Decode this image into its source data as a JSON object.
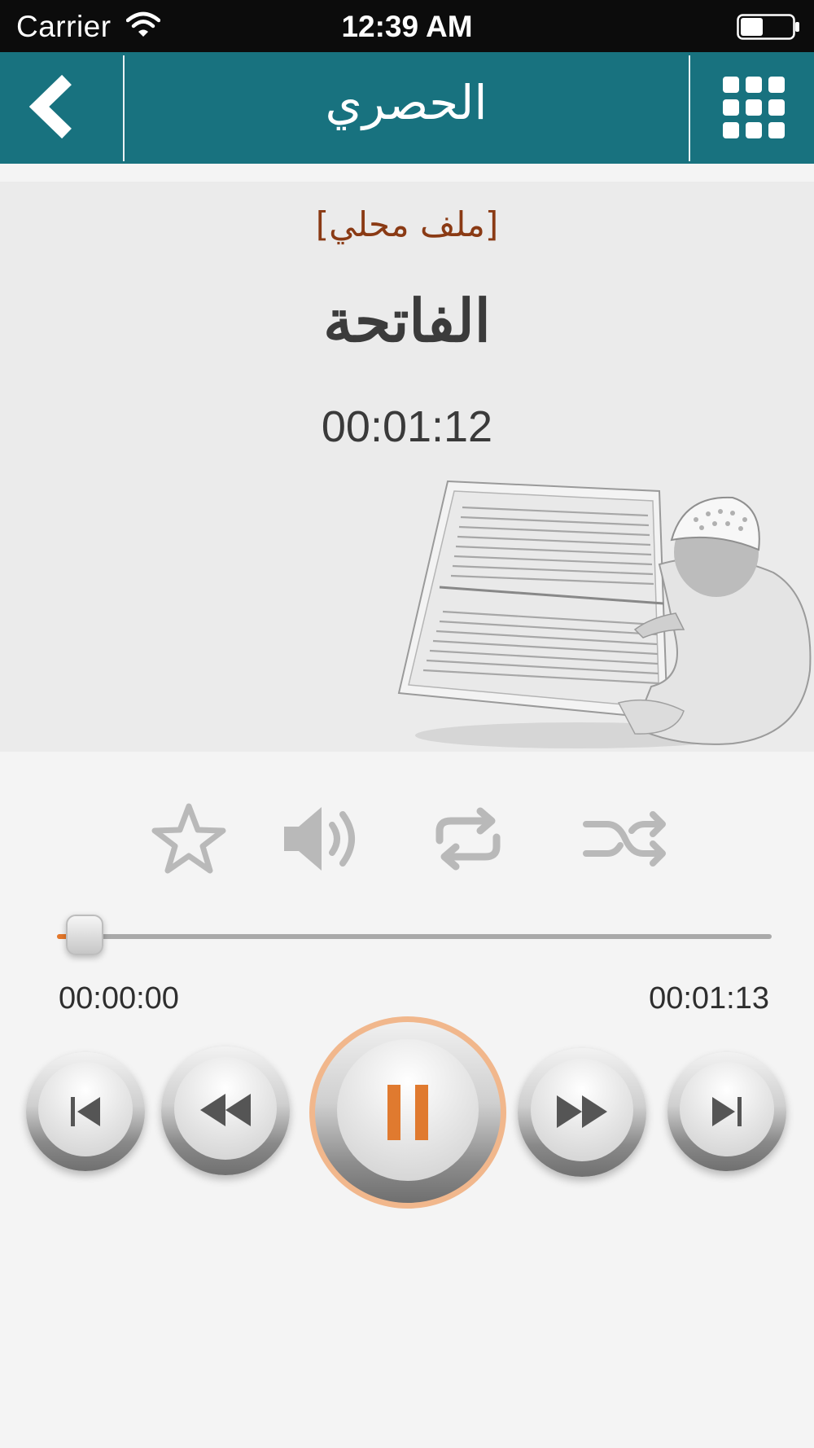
{
  "status_bar": {
    "carrier": "Carrier",
    "time": "12:39 AM",
    "wifi_icon": "wifi-icon",
    "battery_icon": "battery-icon"
  },
  "nav": {
    "title": "الحصري",
    "back_icon": "chevron-left-icon",
    "menu_icon": "grid-menu-icon"
  },
  "player": {
    "source_label": "[ملف محلي]",
    "surah_name": "الفاتحة",
    "current_time": "00:01:12",
    "start_time": "00:00:00",
    "end_time": "00:01:13",
    "progress": 0.02
  },
  "options": {
    "favorite_icon": "star-icon",
    "volume_icon": "volume-icon",
    "repeat_icon": "repeat-icon",
    "shuffle_icon": "shuffle-icon"
  },
  "controls": {
    "prev_track_icon": "skip-back-icon",
    "rewind_icon": "rewind-icon",
    "play_pause_icon": "pause-icon",
    "fast_forward_icon": "fast-forward-icon",
    "next_track_icon": "skip-forward-icon"
  },
  "colors": {
    "nav_bar": "#18727f",
    "accent": "#e5782a",
    "source_label": "#8a3a14"
  }
}
